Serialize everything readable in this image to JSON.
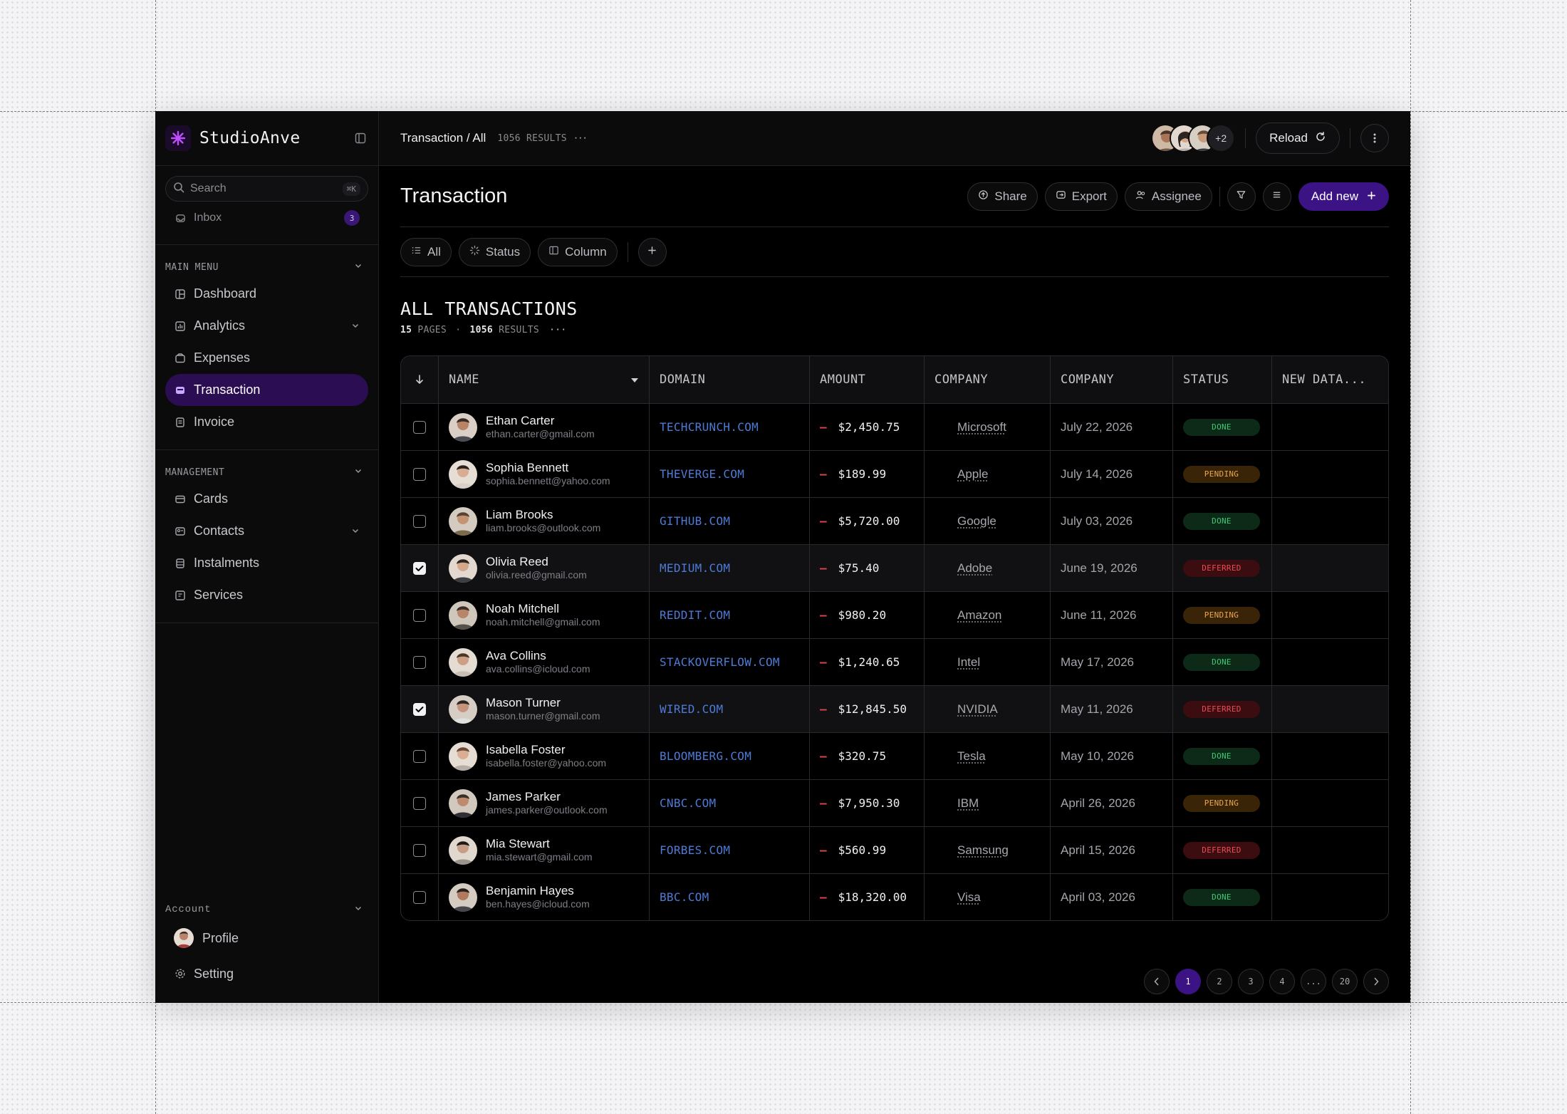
{
  "brand": {
    "name": "StudioAnve"
  },
  "sidebar": {
    "search_placeholder": "Search",
    "search_shortcut": "⌘K",
    "inbox": {
      "label": "Inbox",
      "count": "3"
    },
    "main_menu_title": "MAIN MENU",
    "main_items": [
      {
        "label": "Dashboard",
        "icon": "dashboard-icon"
      },
      {
        "label": "Analytics",
        "icon": "analytics-icon"
      },
      {
        "label": "Expenses",
        "icon": "wallet-icon"
      },
      {
        "label": "Transaction",
        "icon": "transaction-icon",
        "active": true
      },
      {
        "label": "Invoice",
        "icon": "invoice-icon"
      }
    ],
    "management_title": "MANAGEMENT",
    "management_items": [
      {
        "label": "Cards",
        "icon": "card-icon"
      },
      {
        "label": "Contacts",
        "icon": "contacts-icon"
      },
      {
        "label": "Instalments",
        "icon": "instalments-icon"
      },
      {
        "label": "Services",
        "icon": "services-icon"
      }
    ],
    "account_title": "Account",
    "profile_label": "Profile",
    "setting_label": "Setting"
  },
  "topbar": {
    "breadcrumb": "Transaction / All",
    "results": "1056 RESULTS",
    "more_count": "+2",
    "reload_label": "Reload"
  },
  "page": {
    "title": "Transaction",
    "share_label": "Share",
    "export_label": "Export",
    "assignee_label": "Assignee",
    "add_new_label": "Add new",
    "filters": {
      "all": "All",
      "status": "Status",
      "column": "Column"
    },
    "section_title": "ALL TRANSACTIONS",
    "pages_count": "15",
    "pages_word": "PAGES",
    "results_count": "1056",
    "results_word": "RESULTS"
  },
  "table": {
    "headers": [
      "NAME",
      "DOMAIN",
      "AMOUNT",
      "COMPANY",
      "COMPANY",
      "STATUS",
      "NEW DATA..."
    ],
    "rows": [
      {
        "name": "Ethan Carter",
        "email": "ethan.carter@gmail.com",
        "domain": "TECHCRUNCH.COM",
        "amount": "$2,450.75",
        "company": "Microsoft",
        "date": "July 22, 2026",
        "status": "DONE",
        "checked": false
      },
      {
        "name": "Sophia Bennett",
        "email": "sophia.bennett@yahoo.com",
        "domain": "THEVERGE.COM",
        "amount": "$189.99",
        "company": "Apple",
        "date": "July 14, 2026",
        "status": "PENDING",
        "checked": false
      },
      {
        "name": "Liam Brooks",
        "email": "liam.brooks@outlook.com",
        "domain": "GITHUB.COM",
        "amount": "$5,720.00",
        "company": "Google",
        "date": "July 03, 2026",
        "status": "DONE",
        "checked": false
      },
      {
        "name": "Olivia Reed",
        "email": "olivia.reed@gmail.com",
        "domain": "MEDIUM.COM",
        "amount": "$75.40",
        "company": "Adobe",
        "date": "June 19, 2026",
        "status": "DEFERRED",
        "checked": true
      },
      {
        "name": "Noah Mitchell",
        "email": "noah.mitchell@gmail.com",
        "domain": "REDDIT.COM",
        "amount": "$980.20",
        "company": "Amazon",
        "date": "June 11, 2026",
        "status": "PENDING",
        "checked": false
      },
      {
        "name": "Ava Collins",
        "email": "ava.collins@icloud.com",
        "domain": "STACKOVERFLOW.COM",
        "amount": "$1,240.65",
        "company": "Intel",
        "date": "May 17, 2026",
        "status": "DONE",
        "checked": false
      },
      {
        "name": "Mason Turner",
        "email": "mason.turner@gmail.com",
        "domain": "WIRED.COM",
        "amount": "$12,845.50",
        "company": "NVIDIA",
        "date": "May 11, 2026",
        "status": "DEFERRED",
        "checked": true
      },
      {
        "name": "Isabella Foster",
        "email": "isabella.foster@yahoo.com",
        "domain": "BLOOMBERG.COM",
        "amount": "$320.75",
        "company": "Tesla",
        "date": "May 10, 2026",
        "status": "DONE",
        "checked": false
      },
      {
        "name": "James Parker",
        "email": "james.parker@outlook.com",
        "domain": "CNBC.COM",
        "amount": "$7,950.30",
        "company": "IBM",
        "date": "April 26, 2026",
        "status": "PENDING",
        "checked": false
      },
      {
        "name": "Mia Stewart",
        "email": "mia.stewart@gmail.com",
        "domain": "FORBES.COM",
        "amount": "$560.99",
        "company": "Samsung",
        "date": "April 15, 2026",
        "status": "DEFERRED",
        "checked": false
      },
      {
        "name": "Benjamin Hayes",
        "email": "ben.hayes@icloud.com",
        "domain": "BBC.COM",
        "amount": "$18,320.00",
        "company": "Visa",
        "date": "April 03, 2026",
        "status": "DONE",
        "checked": false
      }
    ]
  },
  "pagination": {
    "pages": [
      "1",
      "2",
      "3",
      "4",
      "...",
      "20"
    ],
    "current": "1"
  },
  "colors": {
    "accent": "#3b1384",
    "domain": "#4d7bd6",
    "done": "#3fca73",
    "pending": "#e9a64a",
    "deferred": "#ee4b55"
  }
}
